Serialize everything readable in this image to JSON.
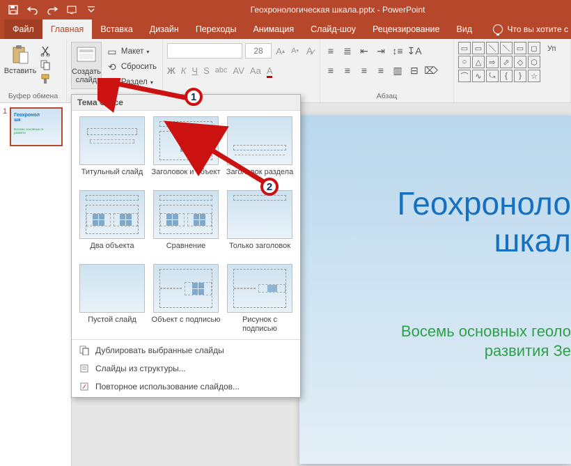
{
  "app": {
    "title": "Геохронологическая шкала.pptx - PowerPoint"
  },
  "tabs": {
    "file": "Файл",
    "items": [
      "Главная",
      "Вставка",
      "Дизайн",
      "Переходы",
      "Анимация",
      "Слайд-шоу",
      "Рецензирование",
      "Вид"
    ],
    "active_index": 0,
    "tell_me": "Что вы хотите с"
  },
  "ribbon": {
    "clipboard": {
      "paste": "Вставить",
      "label": "Буфер обмена"
    },
    "slides": {
      "new_slide": "Создать слайд",
      "layout": "Макет",
      "reset": "Сбросить",
      "section": "Раздел"
    },
    "font": {
      "size": "28"
    },
    "paragraph": {
      "label": "Абзац"
    },
    "shapes": {
      "arrange": "Уп"
    }
  },
  "thumbnail": {
    "number": "1",
    "title": "Геохронол\nшк",
    "subtitle": "Восемь основных ге\nразвити"
  },
  "slide": {
    "title": "Геохроноло\nшкал",
    "subtitle": "Восемь основных геоло\nразвития Зе"
  },
  "layout_menu": {
    "header": "Тема Office",
    "items": [
      "Титульный слайд",
      "Заголовок и объект",
      "Заголовок раздела",
      "Два объекта",
      "Сравнение",
      "Только заголовок",
      "Пустой слайд",
      "Объект с подписью",
      "Рисунок с подписью"
    ],
    "footer": {
      "duplicate": "Дублировать выбранные слайды",
      "outline": "Слайды из структуры...",
      "reuse": "Повторное использование слайдов..."
    }
  },
  "markers": {
    "m1": "1",
    "m2": "2"
  }
}
